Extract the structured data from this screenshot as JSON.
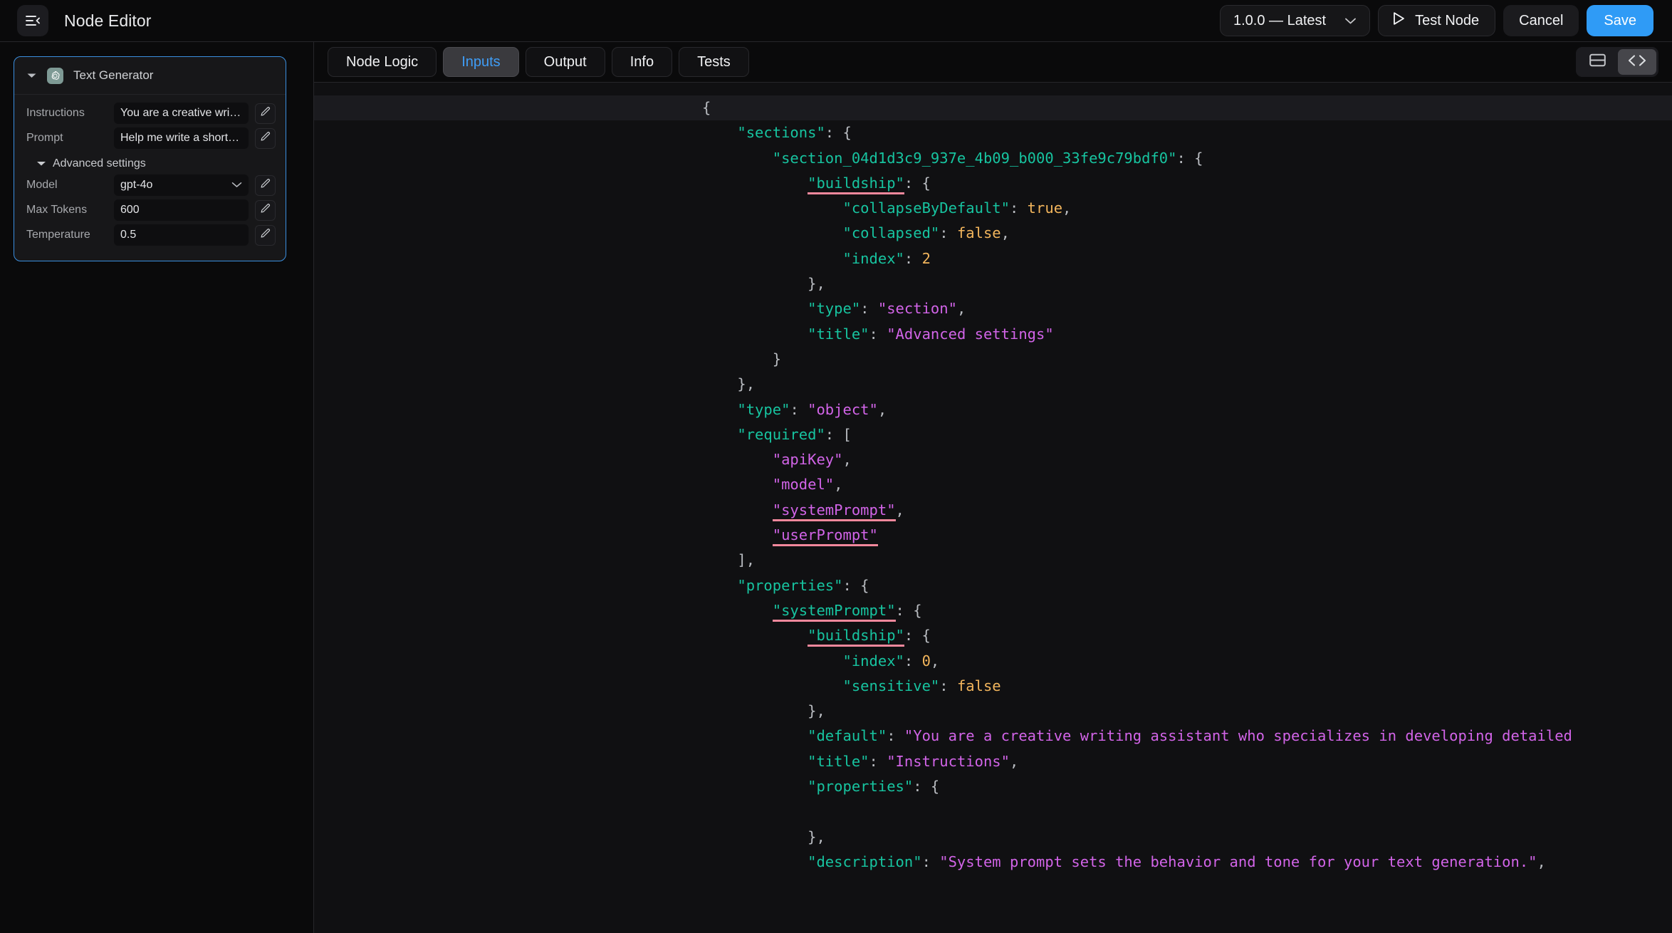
{
  "topbar": {
    "menu_icon": "hamburger-collapse-icon",
    "title": "Node Editor",
    "version_label": "1.0.0 — Latest",
    "test_node_label": "Test Node",
    "play_icon": "play-icon",
    "cancel_label": "Cancel",
    "save_label": "Save",
    "accent_color": "#2f9bf6"
  },
  "node_card": {
    "border_color": "#3b8fe0",
    "caret_icon": "chevron-down-icon",
    "brand_icon": "openai-icon",
    "title": "Text Generator",
    "fields": [
      {
        "label": "Instructions",
        "value": "You are a creative writin...",
        "edit_icon": "pencil-icon"
      },
      {
        "label": "Prompt",
        "value": "Help me write a short st...",
        "edit_icon": "pencil-icon"
      }
    ],
    "section": {
      "label": "Advanced settings",
      "caret_icon": "caret-down-icon"
    },
    "advanced_fields": [
      {
        "label": "Model",
        "value": "gpt-4o",
        "type": "select",
        "dropdown_icon": "chevron-down-icon",
        "edit_icon": "pencil-icon"
      },
      {
        "label": "Max Tokens",
        "value": "600",
        "type": "text",
        "edit_icon": "pencil-icon"
      },
      {
        "label": "Temperature",
        "value": "0.5",
        "type": "text",
        "edit_icon": "pencil-icon"
      }
    ]
  },
  "tabs": [
    {
      "label": "Node Logic",
      "active": false
    },
    {
      "label": "Inputs",
      "active": true
    },
    {
      "label": "Output",
      "active": false
    },
    {
      "label": "Info",
      "active": false
    },
    {
      "label": "Tests",
      "active": false
    }
  ],
  "view_toggles": [
    {
      "icon": "table-view-icon",
      "active": false
    },
    {
      "icon": "code-view-icon",
      "active": true
    }
  ],
  "editor": {
    "language": "json",
    "colors": {
      "key": "#17c4a0",
      "string": "#d264e8",
      "number": "#f2b55c",
      "punctuation": "#b9bcc1",
      "error_underline": "#f2889c",
      "background": "#101012",
      "active_line": "#1b1b1f"
    },
    "lines": [
      [
        {
          "t": "{",
          "c": "p"
        }
      ],
      [
        {
          "t": "    ",
          "c": "p"
        },
        {
          "t": "\"sections\"",
          "c": "k"
        },
        {
          "t": ": {",
          "c": "p"
        }
      ],
      [
        {
          "t": "        ",
          "c": "p"
        },
        {
          "t": "\"section_04d1d3c9_937e_4b09_b000_33fe9c79bdf0\"",
          "c": "k"
        },
        {
          "t": ": {",
          "c": "p"
        }
      ],
      [
        {
          "t": "            ",
          "c": "p"
        },
        {
          "t": "\"buildship\"",
          "c": "k",
          "err": true
        },
        {
          "t": ": {",
          "c": "p"
        }
      ],
      [
        {
          "t": "                ",
          "c": "p"
        },
        {
          "t": "\"collapseByDefault\"",
          "c": "k"
        },
        {
          "t": ": ",
          "c": "p"
        },
        {
          "t": "true",
          "c": "n"
        },
        {
          "t": ",",
          "c": "p"
        }
      ],
      [
        {
          "t": "                ",
          "c": "p"
        },
        {
          "t": "\"collapsed\"",
          "c": "k"
        },
        {
          "t": ": ",
          "c": "p"
        },
        {
          "t": "false",
          "c": "n"
        },
        {
          "t": ",",
          "c": "p"
        }
      ],
      [
        {
          "t": "                ",
          "c": "p"
        },
        {
          "t": "\"index\"",
          "c": "k"
        },
        {
          "t": ": ",
          "c": "p"
        },
        {
          "t": "2",
          "c": "n"
        }
      ],
      [
        {
          "t": "            },",
          "c": "p"
        }
      ],
      [
        {
          "t": "            ",
          "c": "p"
        },
        {
          "t": "\"type\"",
          "c": "k"
        },
        {
          "t": ": ",
          "c": "p"
        },
        {
          "t": "\"section\"",
          "c": "s"
        },
        {
          "t": ",",
          "c": "p"
        }
      ],
      [
        {
          "t": "            ",
          "c": "p"
        },
        {
          "t": "\"title\"",
          "c": "k"
        },
        {
          "t": ": ",
          "c": "p"
        },
        {
          "t": "\"Advanced settings\"",
          "c": "s"
        }
      ],
      [
        {
          "t": "        }",
          "c": "p"
        }
      ],
      [
        {
          "t": "    },",
          "c": "p"
        }
      ],
      [
        {
          "t": "    ",
          "c": "p"
        },
        {
          "t": "\"type\"",
          "c": "k"
        },
        {
          "t": ": ",
          "c": "p"
        },
        {
          "t": "\"object\"",
          "c": "s"
        },
        {
          "t": ",",
          "c": "p"
        }
      ],
      [
        {
          "t": "    ",
          "c": "p"
        },
        {
          "t": "\"required\"",
          "c": "k"
        },
        {
          "t": ": [",
          "c": "p"
        }
      ],
      [
        {
          "t": "        ",
          "c": "p"
        },
        {
          "t": "\"apiKey\"",
          "c": "s"
        },
        {
          "t": ",",
          "c": "p"
        }
      ],
      [
        {
          "t": "        ",
          "c": "p"
        },
        {
          "t": "\"model\"",
          "c": "s"
        },
        {
          "t": ",",
          "c": "p"
        }
      ],
      [
        {
          "t": "        ",
          "c": "p"
        },
        {
          "t": "\"systemPrompt\"",
          "c": "s",
          "err": true
        },
        {
          "t": ",",
          "c": "p"
        }
      ],
      [
        {
          "t": "        ",
          "c": "p"
        },
        {
          "t": "\"userPrompt\"",
          "c": "s",
          "err": true
        }
      ],
      [
        {
          "t": "    ],",
          "c": "p"
        }
      ],
      [
        {
          "t": "    ",
          "c": "p"
        },
        {
          "t": "\"properties\"",
          "c": "k"
        },
        {
          "t": ": {",
          "c": "p"
        }
      ],
      [
        {
          "t": "        ",
          "c": "p"
        },
        {
          "t": "\"systemPrompt\"",
          "c": "k",
          "err": true
        },
        {
          "t": ": {",
          "c": "p"
        }
      ],
      [
        {
          "t": "            ",
          "c": "p"
        },
        {
          "t": "\"buildship\"",
          "c": "k",
          "err": true
        },
        {
          "t": ": {",
          "c": "p"
        }
      ],
      [
        {
          "t": "                ",
          "c": "p"
        },
        {
          "t": "\"index\"",
          "c": "k"
        },
        {
          "t": ": ",
          "c": "p"
        },
        {
          "t": "0",
          "c": "n"
        },
        {
          "t": ",",
          "c": "p"
        }
      ],
      [
        {
          "t": "                ",
          "c": "p"
        },
        {
          "t": "\"sensitive\"",
          "c": "k"
        },
        {
          "t": ": ",
          "c": "p"
        },
        {
          "t": "false",
          "c": "n"
        }
      ],
      [
        {
          "t": "            },",
          "c": "p"
        }
      ],
      [
        {
          "t": "            ",
          "c": "p"
        },
        {
          "t": "\"default\"",
          "c": "k"
        },
        {
          "t": ": ",
          "c": "p"
        },
        {
          "t": "\"You are a creative writing assistant who specializes in developing detailed",
          "c": "s"
        }
      ],
      [
        {
          "t": "            ",
          "c": "p"
        },
        {
          "t": "\"title\"",
          "c": "k"
        },
        {
          "t": ": ",
          "c": "p"
        },
        {
          "t": "\"Instructions\"",
          "c": "s"
        },
        {
          "t": ",",
          "c": "p"
        }
      ],
      [
        {
          "t": "            ",
          "c": "p"
        },
        {
          "t": "\"properties\"",
          "c": "k"
        },
        {
          "t": ": {",
          "c": "p"
        }
      ],
      [
        {
          "t": "",
          "c": "p"
        }
      ],
      [
        {
          "t": "            },",
          "c": "p"
        }
      ],
      [
        {
          "t": "            ",
          "c": "p"
        },
        {
          "t": "\"description\"",
          "c": "k"
        },
        {
          "t": ": ",
          "c": "p"
        },
        {
          "t": "\"System prompt sets the behavior and tone for your text generation.\"",
          "c": "s"
        },
        {
          "t": ",",
          "c": "p"
        }
      ]
    ]
  }
}
